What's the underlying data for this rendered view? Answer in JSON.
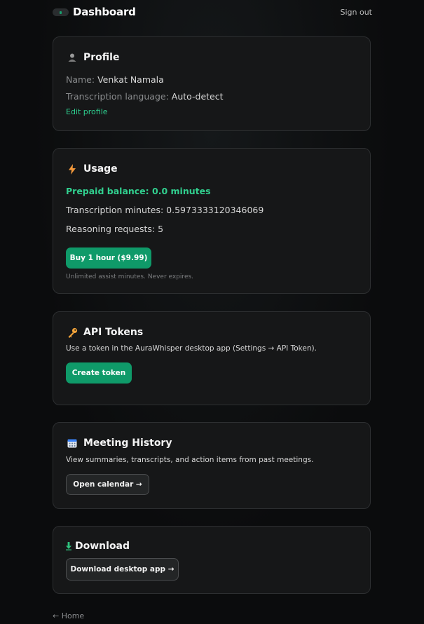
{
  "header": {
    "title": "Dashboard",
    "signout": "Sign out"
  },
  "profile": {
    "title": "Profile",
    "icon": "person-icon",
    "name_label": "Name:",
    "name_value": "Venkat Namala",
    "lang_label": "Transcription language:",
    "lang_value": "Auto-detect",
    "edit": "Edit profile"
  },
  "usage": {
    "title": "Usage",
    "icon": "lightning-icon",
    "balance": "Prepaid balance: 0.0 minutes",
    "minutes": "Transcription minutes: 0.5973333120346069",
    "reasoning": "Reasoning requests: 5",
    "buy_button": "Buy 1 hour ($9.99)",
    "note": "Unlimited assist minutes. Never expires."
  },
  "tokens": {
    "title": "API Tokens",
    "icon": "key-icon",
    "desc": "Use a token in the AuraWhisper desktop app (Settings → API Token).",
    "create_button": "Create token"
  },
  "history": {
    "title": "Meeting History",
    "icon": "calendar-icon",
    "desc": "View summaries, transcripts, and action items from past meetings.",
    "open_button": "Open calendar →"
  },
  "download": {
    "title": "Download",
    "icon": "download-arrow-icon",
    "button": "Download desktop app →"
  },
  "footer": {
    "home": "← Home"
  },
  "colors": {
    "accent": "#0f9a69",
    "accent_text": "#31d08f",
    "card_bg": "#161718",
    "page_bg": "#0b0c0d"
  }
}
